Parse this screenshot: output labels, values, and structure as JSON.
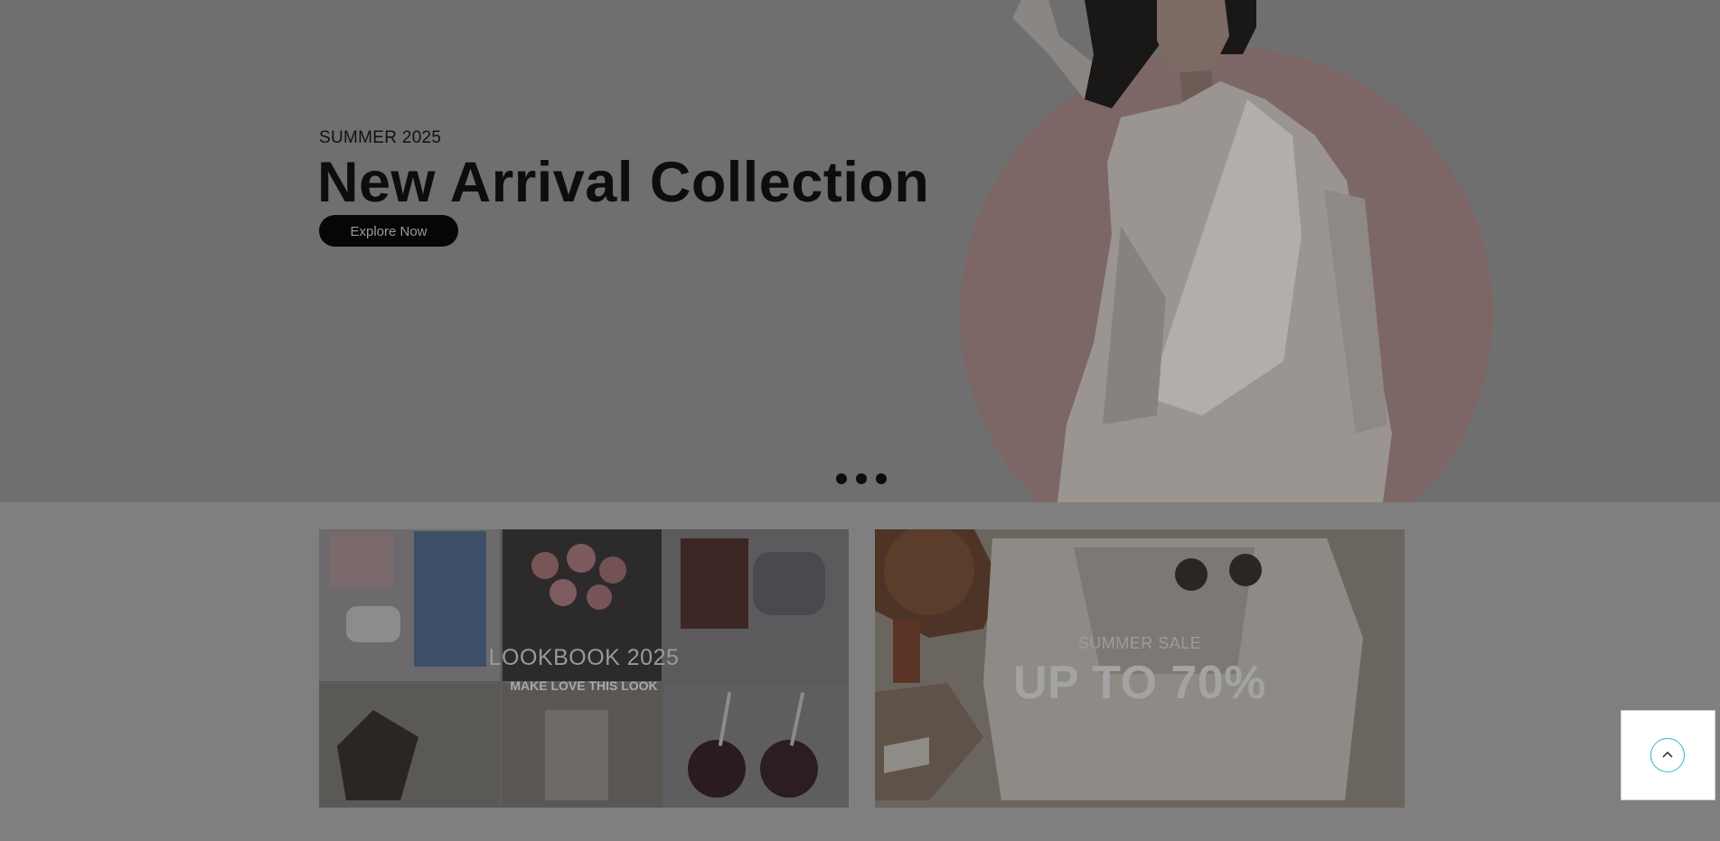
{
  "hero": {
    "subtitle": "SUMMER 2025",
    "title": "New Arrival Collection",
    "cta_label": "Explore Now",
    "slide_dots": 3
  },
  "banners": {
    "lookbook": {
      "title": "LOOKBOOK 2025",
      "subtitle": "MAKE LOVE THIS LOOK"
    },
    "sale": {
      "subtitle": "SUMMER SALE",
      "title": "UP TO 70%"
    }
  },
  "scroll_top": {
    "icon": "chevron-up-icon"
  },
  "colors": {
    "overlay": "#7f7f7f",
    "circle_accent": "#7d6766",
    "scroll_ring": "#2fb8c9"
  }
}
